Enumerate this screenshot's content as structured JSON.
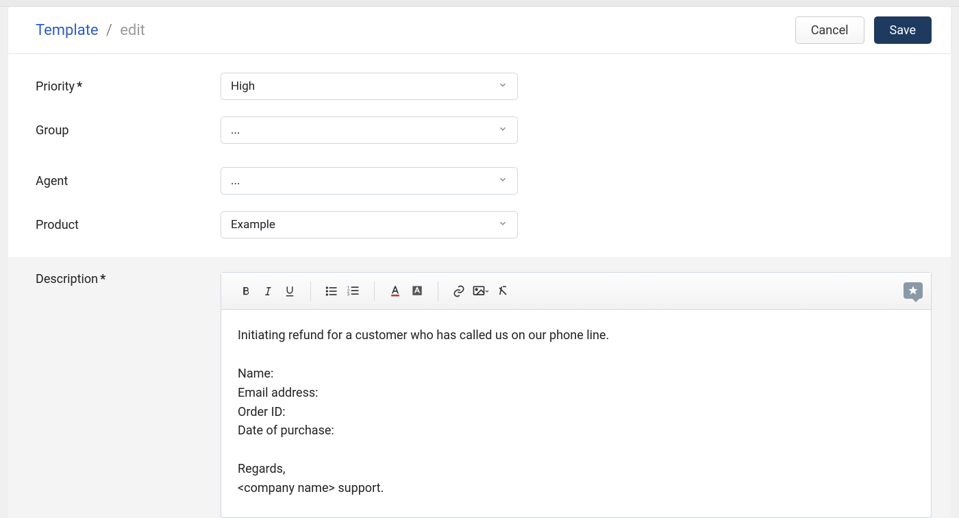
{
  "header": {
    "breadcrumb_root": "Template",
    "breadcrumb_sep": "/",
    "breadcrumb_leaf": "edit",
    "cancel_label": "Cancel",
    "save_label": "Save"
  },
  "fields": {
    "priority": {
      "label": "Priority",
      "required": "*",
      "value": "High"
    },
    "group": {
      "label": "Group",
      "required": "",
      "value": "..."
    },
    "agent": {
      "label": "Agent",
      "required": "",
      "value": "..."
    },
    "product": {
      "label": "Product",
      "required": "",
      "value": "Example"
    },
    "description": {
      "label": "Description",
      "required": "*"
    }
  },
  "editor": {
    "content": "Initiating refund for a customer who has called us on our phone line.\n\nName:\nEmail address:\nOrder ID:\nDate of purchase:\n\nRegards,\n<company name> support."
  }
}
